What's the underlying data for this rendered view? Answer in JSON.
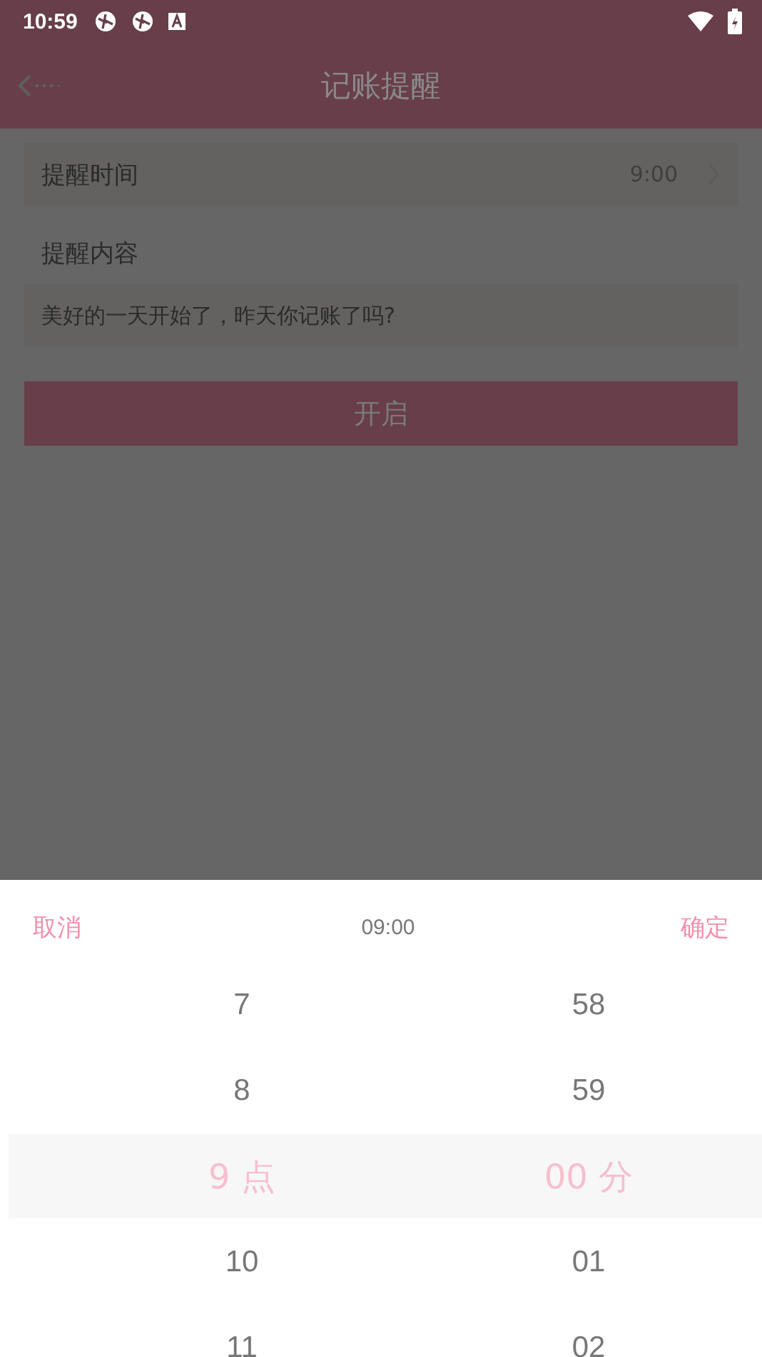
{
  "status_bar": {
    "time": "10:59"
  },
  "app_bar": {
    "title": "记账提醒"
  },
  "reminder_time": {
    "label": "提醒时间",
    "value": "9:00"
  },
  "reminder_content": {
    "label": "提醒内容",
    "value": "美好的一天开始了，昨天你记账了吗?"
  },
  "enable_button": "开启",
  "time_picker": {
    "cancel": "取消",
    "title": "09:00",
    "confirm": "确定",
    "columns": [
      {
        "unit": "点",
        "items": [
          {
            "label": "7",
            "selected": false
          },
          {
            "label": "8",
            "selected": false
          },
          {
            "label": "9",
            "selected": true
          },
          {
            "label": "10",
            "selected": false
          },
          {
            "label": "11",
            "selected": false
          }
        ]
      },
      {
        "unit": "分",
        "items": [
          {
            "label": "58",
            "selected": false
          },
          {
            "label": "59",
            "selected": false
          },
          {
            "label": "00",
            "selected": true
          },
          {
            "label": "01",
            "selected": false
          },
          {
            "label": "02",
            "selected": false
          }
        ]
      }
    ]
  }
}
